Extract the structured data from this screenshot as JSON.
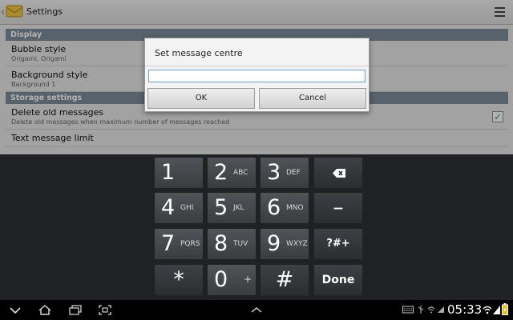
{
  "actionbar": {
    "title": "Settings",
    "app_icon": "messaging-icon",
    "menu_icon": "menu-icon"
  },
  "settings": {
    "display_header": "Display",
    "bubble_style": {
      "title": "Bubble style",
      "summary": "Origami, Origami"
    },
    "background_style": {
      "title": "Background style",
      "summary": "Background 1"
    },
    "storage_header": "Storage settings",
    "delete_old": {
      "title": "Delete old messages",
      "summary": "Delete old messages when maximum number of messages reached",
      "checked": true
    },
    "text_limit": {
      "title": "Text message limit"
    }
  },
  "dialog": {
    "title": "Set message centre",
    "input_value": "",
    "ok_label": "OK",
    "cancel_label": "Cancel"
  },
  "keypad": {
    "keys": [
      {
        "num": "1",
        "letters": ""
      },
      {
        "num": "2",
        "letters": "ABC"
      },
      {
        "num": "3",
        "letters": "DEF"
      },
      {
        "num": "4",
        "letters": "GHI"
      },
      {
        "num": "5",
        "letters": "JKL"
      },
      {
        "num": "6",
        "letters": "MNO"
      },
      {
        "num": "7",
        "letters": "PQRS"
      },
      {
        "num": "8",
        "letters": "TUV"
      },
      {
        "num": "9",
        "letters": "WXYZ"
      },
      {
        "num": "0",
        "letters": "+"
      }
    ],
    "star": "*",
    "hash": "#",
    "minus": "–",
    "symbols": "?#+",
    "done": "Done",
    "backspace_icon": "backspace-icon"
  },
  "status_bar": {
    "time": "05:33",
    "icons": [
      "back-icon",
      "home-icon",
      "recent-apps-icon",
      "screenshot-icon",
      "up-chevron-icon",
      "keyboard-icon",
      "usb-icon",
      "wifi-icon",
      "signal-icon",
      "battery-icon"
    ]
  },
  "colors": {
    "section_header": "#7d8d9b",
    "keypad_bg": "#1f2124",
    "key_face": "#46494d",
    "checkmark": "#2c9a2c",
    "input_focus": "#6aa0cf"
  }
}
